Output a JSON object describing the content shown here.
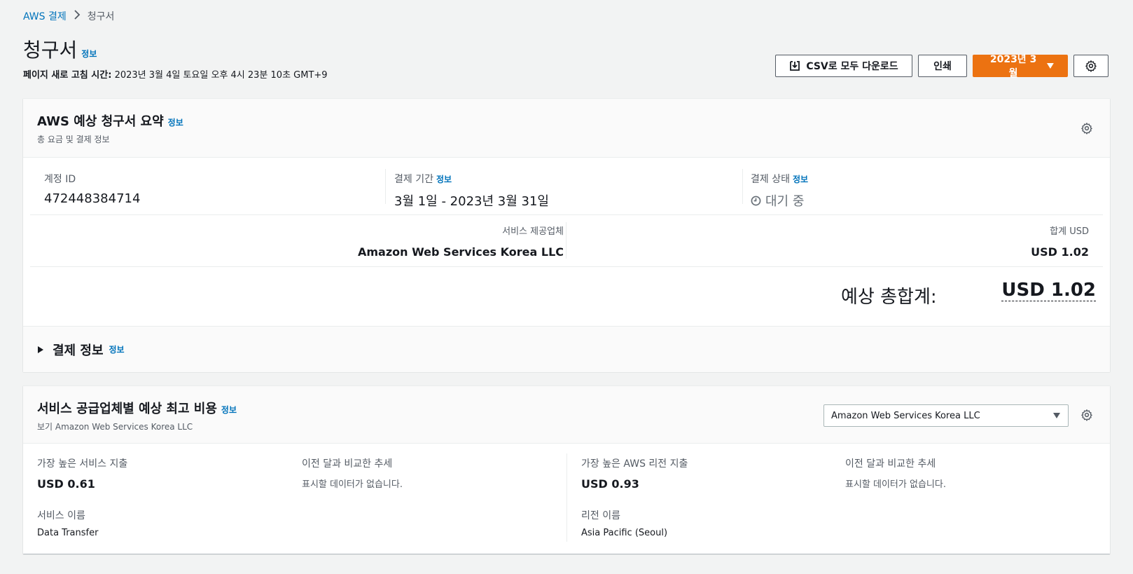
{
  "breadcrumb": {
    "parent": "AWS 결제",
    "current": "청구서"
  },
  "page": {
    "title": "청구서",
    "info": "정보",
    "refresh_label": "페이지 새로 고침 시간:",
    "refresh_value": "2023년 3월 4일 토요일 오후 4시 23분 10초 GMT+9"
  },
  "actions": {
    "csv": "CSV로 모두 다운로드",
    "print": "인쇄",
    "month": "2023년 3월"
  },
  "summary": {
    "title": "AWS 예상 청구서 요약",
    "info": "정보",
    "subtitle": "총 요금 및 결제 정보",
    "account_label": "계정 ID",
    "account_value": "472448384714",
    "period_label": "결제 기간",
    "period_info": "정보",
    "period_value": "3월 1일 - 2023년 3월 31일",
    "status_label": "결제 상태",
    "status_info": "정보",
    "status_value": "대기 중",
    "provider_label": "서비스 제공업체",
    "provider_value": "Amazon Web Services Korea LLC",
    "total_label": "합계 USD",
    "total_value": "USD 1.02",
    "grand_label": "예상 총합계:",
    "grand_value": "USD 1.02",
    "payment_info": "결제 정보",
    "payment_info_link": "정보"
  },
  "top_costs": {
    "title": "서비스 공급업체별 예상 최고 비용",
    "info": "정보",
    "subtitle": "보기 Amazon Web Services Korea LLC",
    "select_value": "Amazon Web Services Korea LLC",
    "service_spend_label": "가장 높은 서비스 지출",
    "service_spend_value": "USD 0.61",
    "trend1_label": "이전 달과 비교한 추세",
    "trend1_value": "표시할 데이터가 없습니다.",
    "service_name_label": "서비스 이름",
    "service_name_value": "Data Transfer",
    "region_spend_label": "가장 높은 AWS 리전 지출",
    "region_spend_value": "USD 0.93",
    "trend2_label": "이전 달과 비교한 추세",
    "trend2_value": "표시할 데이터가 없습니다.",
    "region_name_label": "리전 이름",
    "region_name_value": "Asia Pacific (Seoul)"
  }
}
